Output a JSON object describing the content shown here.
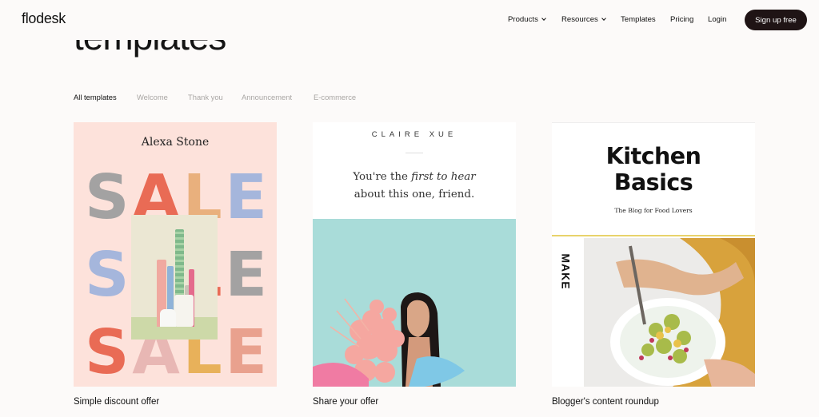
{
  "nav": {
    "logo": "flodesk",
    "items": [
      {
        "label": "Products",
        "dropdown": true
      },
      {
        "label": "Resources",
        "dropdown": true
      },
      {
        "label": "Templates",
        "dropdown": false
      },
      {
        "label": "Pricing",
        "dropdown": false
      },
      {
        "label": "Login",
        "dropdown": false
      }
    ],
    "signup_label": "Sign up free"
  },
  "page": {
    "heading": "templates"
  },
  "filters": [
    {
      "label": "All templates",
      "active": true
    },
    {
      "label": "Welcome",
      "active": false
    },
    {
      "label": "Thank you",
      "active": false
    },
    {
      "label": "Announcement",
      "active": false
    },
    {
      "label": "E-commerce",
      "active": false
    }
  ],
  "templates": [
    {
      "caption": "Simple discount offer",
      "preview_name": "Alexa Stone",
      "sale_word": "SALE",
      "colors": [
        "#a3a2a2",
        "#e96b55",
        "#e9b07d",
        "#a5b6dc",
        "#e8b15a"
      ]
    },
    {
      "caption": "Share your offer",
      "preview_name": "CLAIRE XUE",
      "line1_a": "You're the ",
      "line1_em": "first to hear",
      "line2": "about this one, friend."
    },
    {
      "caption": "Blogger's content roundup",
      "title_line1": "Kitchen",
      "title_line2": "Basics",
      "tagline": "The Blog for Food Lovers",
      "side_word": "MAKE"
    }
  ]
}
